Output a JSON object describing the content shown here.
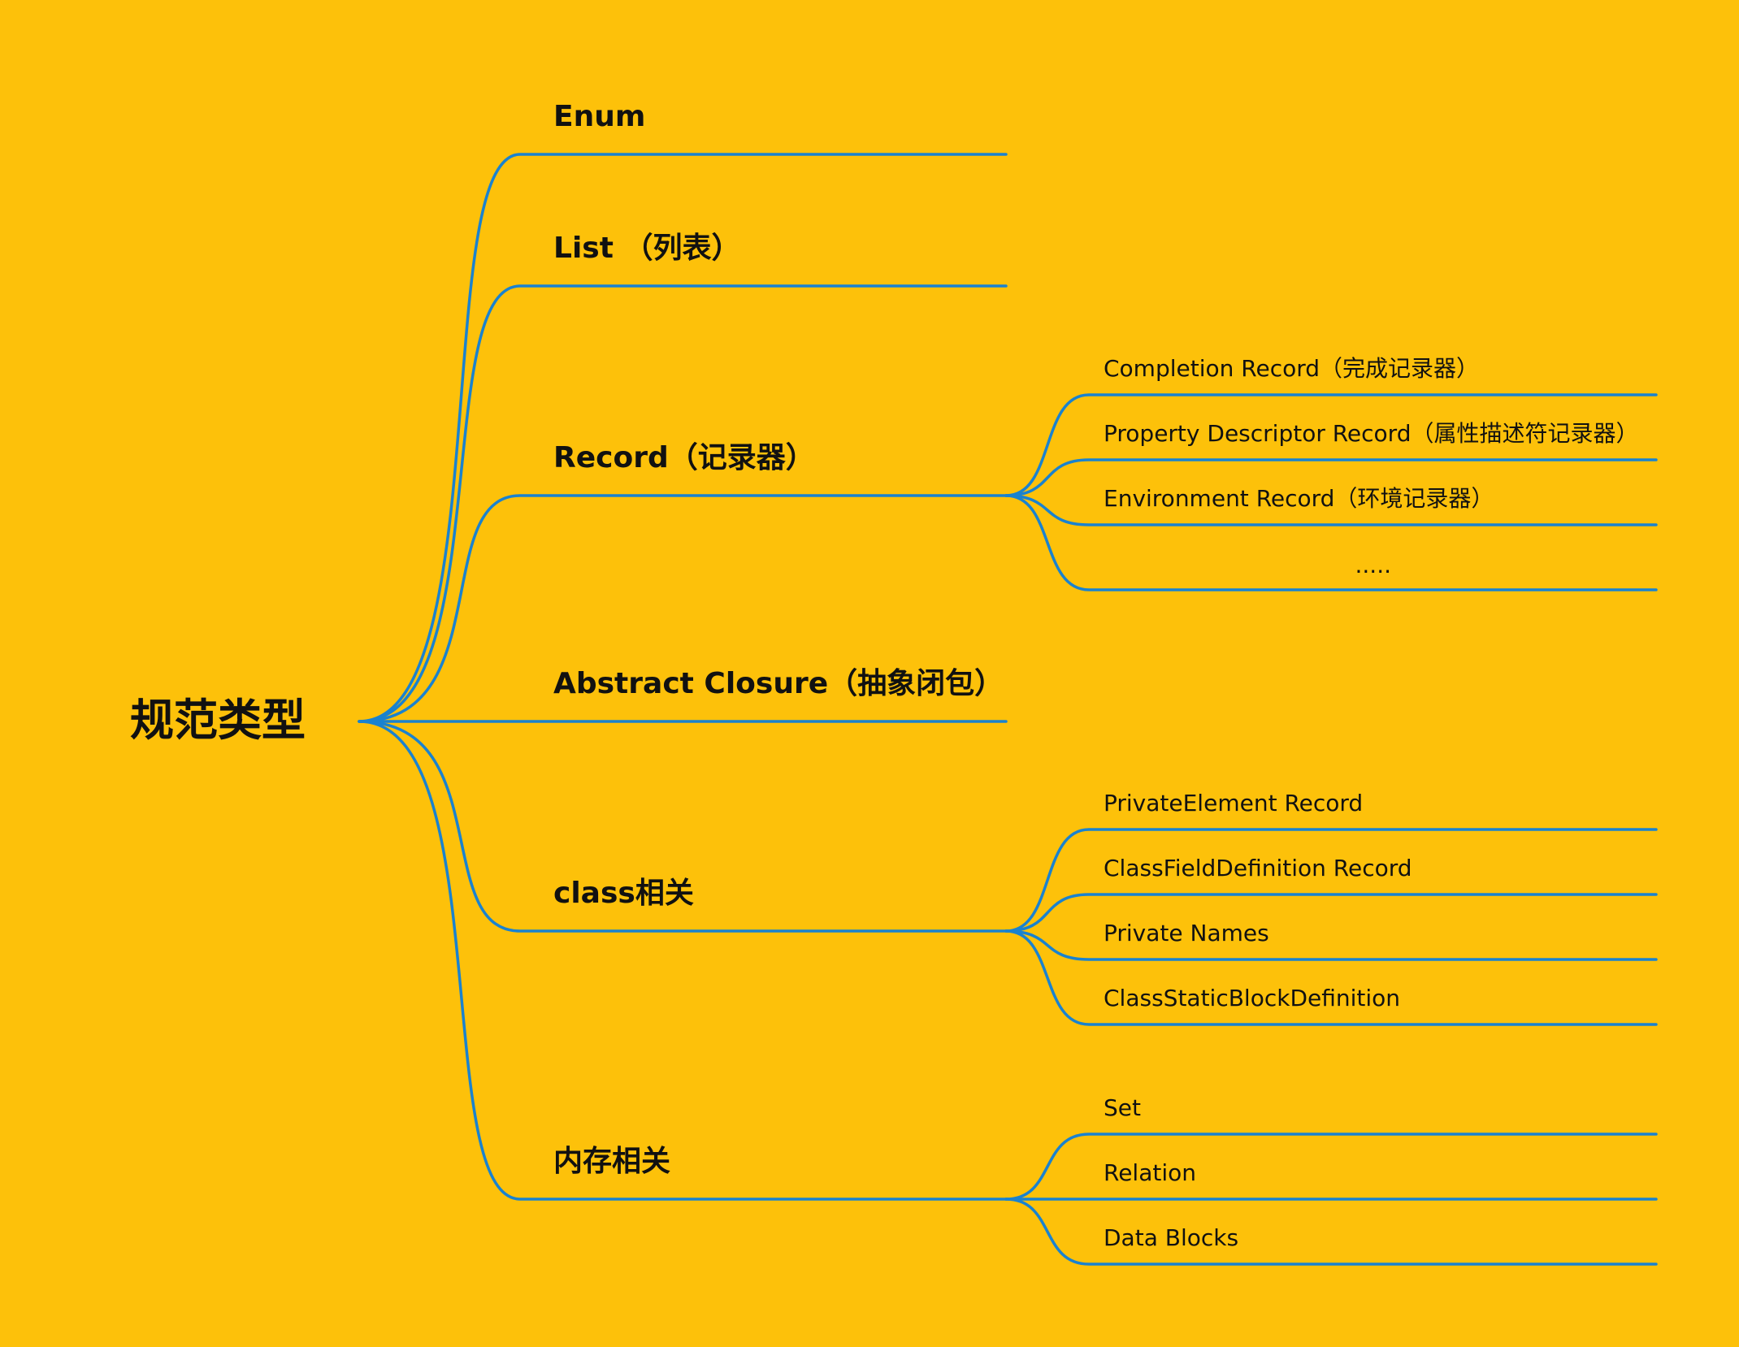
{
  "colors": {
    "background": "#FDC10A",
    "line": "#1A82CF",
    "text": "#111111"
  },
  "root": {
    "label": "规范类型"
  },
  "branches": [
    {
      "label": "Enum",
      "children": []
    },
    {
      "label": "List （列表）",
      "children": []
    },
    {
      "label": "Record（记录器）",
      "children": [
        "Completion Record（完成记录器）",
        "Property Descriptor Record（属性描述符记录器）",
        "Environment Record（环境记录器）",
        "....."
      ]
    },
    {
      "label": "Abstract Closure（抽象闭包）",
      "children": []
    },
    {
      "label": "class相关",
      "children": [
        "PrivateElement Record",
        "ClassFieldDefinition Record",
        "Private Names",
        "ClassStaticBlockDefinition"
      ]
    },
    {
      "label": "内存相关",
      "children": [
        "Set",
        "Relation",
        "Data Blocks"
      ]
    }
  ]
}
